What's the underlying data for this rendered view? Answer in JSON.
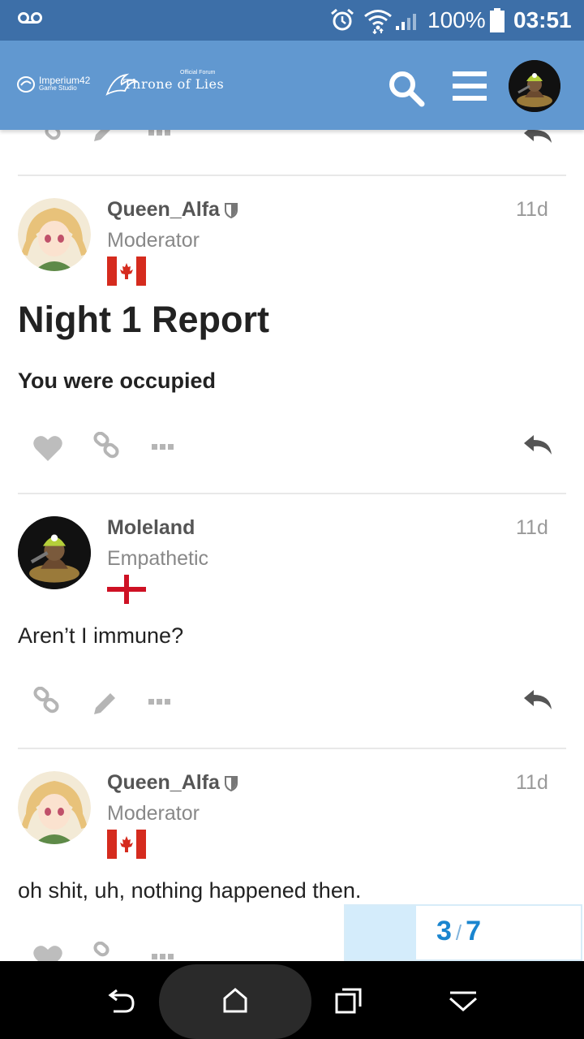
{
  "status_bar": {
    "battery": "100%",
    "time": "03:51",
    "icons": [
      "voicemail-icon",
      "alarm-icon",
      "wifi-icon",
      "signal-icon",
      "battery-icon"
    ]
  },
  "header": {
    "studio_name": "Imperium42",
    "studio_sub": "Game Studio",
    "forum_tag": "Official Forum",
    "forum_title": "Throne of Lies",
    "colors": {
      "header_bg": "#6198d0",
      "status_bg": "#3d6fa8"
    }
  },
  "posts": [
    {
      "username": "Queen_Alfa",
      "role": "Moderator",
      "time": "11d",
      "flag": "canada-flag",
      "heading": "Night 1 Report",
      "strong": "You were occupied"
    },
    {
      "username": "Moleland",
      "role": "Empathetic",
      "time": "11d",
      "flag": "england-flag",
      "text": "Aren’t I immune?"
    },
    {
      "username": "Queen_Alfa",
      "role": "Moderator",
      "time": "11d",
      "flag": "canada-flag",
      "text": "oh shit, uh, nothing happened then."
    }
  ],
  "progress": {
    "current": "3",
    "separator": "/",
    "total": "7",
    "fraction": 0.3
  },
  "accent": "#1a85cf"
}
